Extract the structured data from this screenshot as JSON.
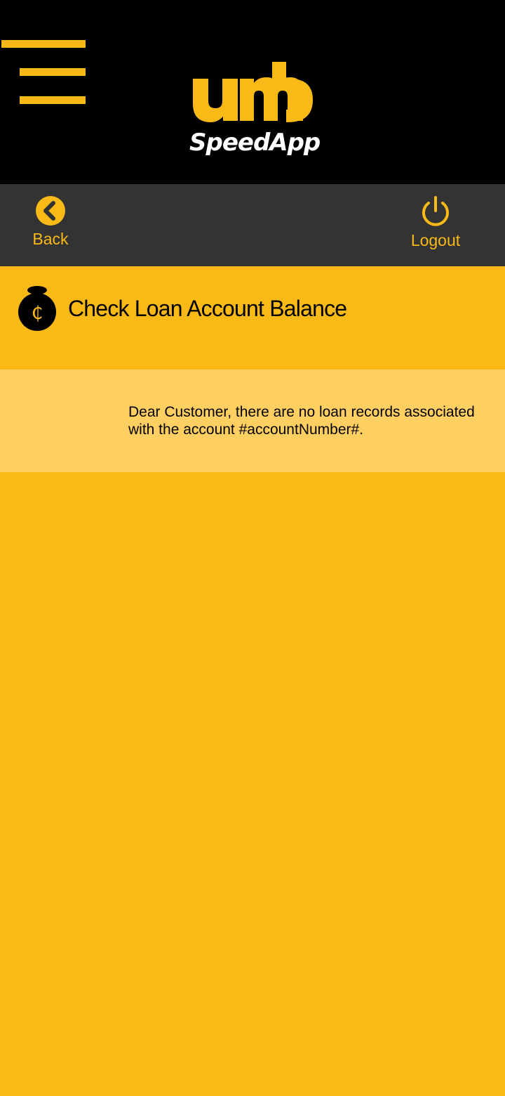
{
  "header": {
    "logo_mark": "umb",
    "logo_text": "SpeedApp",
    "menu_icon": "hamburger-menu-icon"
  },
  "nav": {
    "back_label": "Back",
    "back_icon": "chevron-left-circle-icon",
    "logout_label": "Logout",
    "logout_icon": "power-icon"
  },
  "page": {
    "title": "Check Loan Account Balance",
    "title_icon": "money-bag-cedi-icon",
    "title_icon_symbol": "₵"
  },
  "message": {
    "text": "Dear Customer, there are no loan records associated with the account #accountNumber#."
  },
  "colors": {
    "brand_yellow": "#F9BA18",
    "message_bg": "#FFCF62",
    "header_bg": "#000000",
    "nav_bg": "#333333"
  }
}
